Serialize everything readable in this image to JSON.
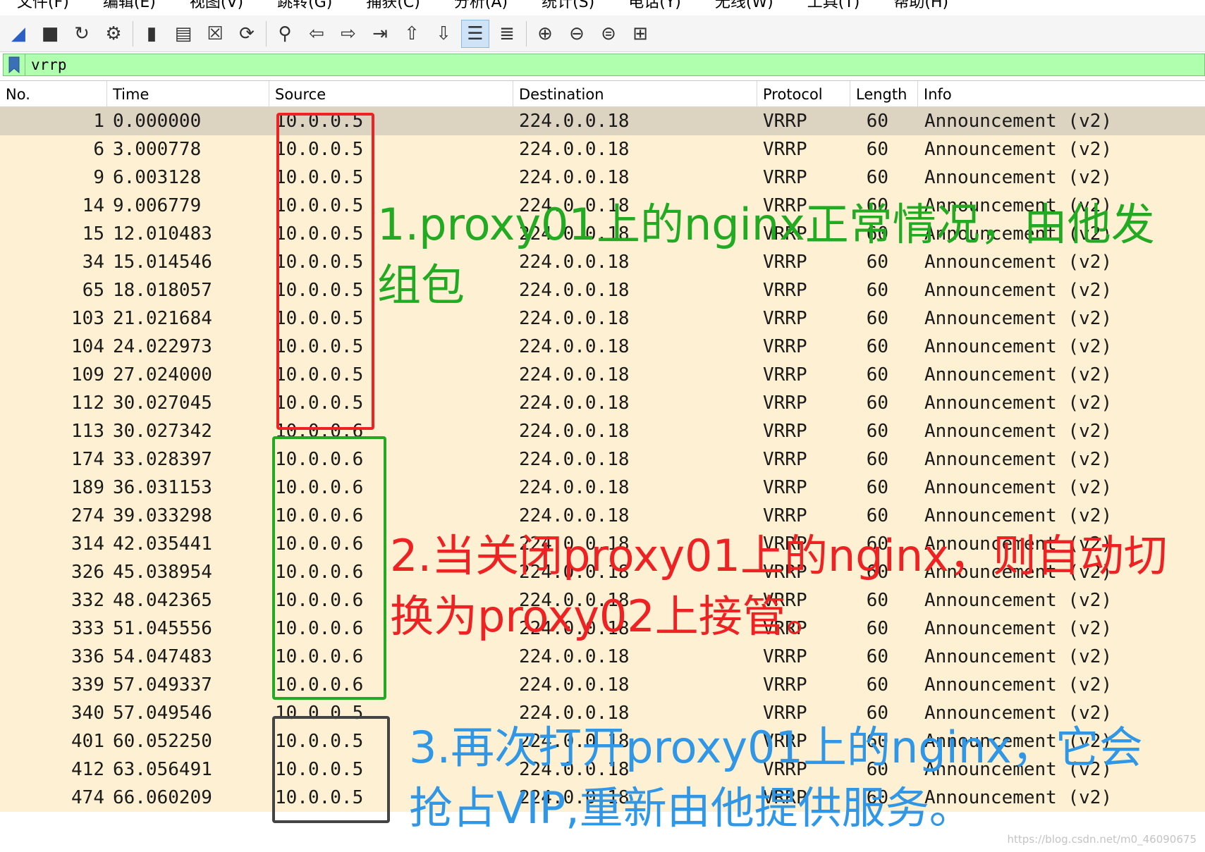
{
  "menu": {
    "items": [
      "文件(F)",
      "编辑(E)",
      "视图(V)",
      "跳转(G)",
      "捕获(C)",
      "分析(A)",
      "统计(S)",
      "电话(Y)",
      "无线(W)",
      "工具(T)",
      "帮助(H)"
    ]
  },
  "toolbar": {
    "buttons": [
      {
        "icon": "shark-fin-start-icon",
        "glyph": "◢"
      },
      {
        "icon": "stop-square-icon",
        "glyph": "■"
      },
      {
        "icon": "restart-fin-icon",
        "glyph": "↻"
      },
      {
        "icon": "capture-options-gear-icon",
        "glyph": "⚙"
      },
      {
        "icon": "open-folder-icon",
        "glyph": "▮"
      },
      {
        "icon": "save-file-icon",
        "glyph": "▤"
      },
      {
        "icon": "close-file-icon",
        "glyph": "☒"
      },
      {
        "icon": "reload-icon",
        "glyph": "⟳"
      },
      {
        "icon": "find-packet-icon",
        "glyph": "⚲"
      },
      {
        "icon": "go-back-icon",
        "glyph": "⇦"
      },
      {
        "icon": "go-forward-icon",
        "glyph": "⇨"
      },
      {
        "icon": "go-to-packet-icon",
        "glyph": "⇥"
      },
      {
        "icon": "go-first-icon",
        "glyph": "⇧"
      },
      {
        "icon": "go-last-icon",
        "glyph": "⇩"
      },
      {
        "icon": "auto-scroll-icon",
        "glyph": "☰"
      },
      {
        "icon": "colorize-icon",
        "glyph": "≣"
      },
      {
        "icon": "zoom-in-icon",
        "glyph": "⊕"
      },
      {
        "icon": "zoom-out-icon",
        "glyph": "⊖"
      },
      {
        "icon": "normal-size-icon",
        "glyph": "⊜"
      },
      {
        "icon": "resize-columns-icon",
        "glyph": "⊞"
      }
    ]
  },
  "filter": {
    "value": "vrrp",
    "bookmark_icon": "bookmark-icon",
    "background_color": "#afffaf"
  },
  "columns": {
    "no": "No.",
    "time": "Time",
    "source": "Source",
    "destination": "Destination",
    "protocol": "Protocol",
    "length": "Length",
    "info": "Info"
  },
  "packets": [
    {
      "no": "1",
      "time": "0.000000",
      "src": "10.0.0.5",
      "dst": "224.0.0.18",
      "proto": "VRRP",
      "len": "60",
      "info": "Announcement (v2)"
    },
    {
      "no": "6",
      "time": "3.000778",
      "src": "10.0.0.5",
      "dst": "224.0.0.18",
      "proto": "VRRP",
      "len": "60",
      "info": "Announcement (v2)"
    },
    {
      "no": "9",
      "time": "6.003128",
      "src": "10.0.0.5",
      "dst": "224.0.0.18",
      "proto": "VRRP",
      "len": "60",
      "info": "Announcement (v2)"
    },
    {
      "no": "14",
      "time": "9.006779",
      "src": "10.0.0.5",
      "dst": "224.0.0.18",
      "proto": "VRRP",
      "len": "60",
      "info": "Announcement (v2)"
    },
    {
      "no": "15",
      "time": "12.010483",
      "src": "10.0.0.5",
      "dst": "224.0.0.18",
      "proto": "VRRP",
      "len": "60",
      "info": "Announcement (v2)"
    },
    {
      "no": "34",
      "time": "15.014546",
      "src": "10.0.0.5",
      "dst": "224.0.0.18",
      "proto": "VRRP",
      "len": "60",
      "info": "Announcement (v2)"
    },
    {
      "no": "65",
      "time": "18.018057",
      "src": "10.0.0.5",
      "dst": "224.0.0.18",
      "proto": "VRRP",
      "len": "60",
      "info": "Announcement (v2)"
    },
    {
      "no": "103",
      "time": "21.021684",
      "src": "10.0.0.5",
      "dst": "224.0.0.18",
      "proto": "VRRP",
      "len": "60",
      "info": "Announcement (v2)"
    },
    {
      "no": "104",
      "time": "24.022973",
      "src": "10.0.0.5",
      "dst": "224.0.0.18",
      "proto": "VRRP",
      "len": "60",
      "info": "Announcement (v2)"
    },
    {
      "no": "109",
      "time": "27.024000",
      "src": "10.0.0.5",
      "dst": "224.0.0.18",
      "proto": "VRRP",
      "len": "60",
      "info": "Announcement (v2)"
    },
    {
      "no": "112",
      "time": "30.027045",
      "src": "10.0.0.5",
      "dst": "224.0.0.18",
      "proto": "VRRP",
      "len": "60",
      "info": "Announcement (v2)"
    },
    {
      "no": "113",
      "time": "30.027342",
      "src": "10.0.0.6",
      "dst": "224.0.0.18",
      "proto": "VRRP",
      "len": "60",
      "info": "Announcement (v2)"
    },
    {
      "no": "174",
      "time": "33.028397",
      "src": "10.0.0.6",
      "dst": "224.0.0.18",
      "proto": "VRRP",
      "len": "60",
      "info": "Announcement (v2)"
    },
    {
      "no": "189",
      "time": "36.031153",
      "src": "10.0.0.6",
      "dst": "224.0.0.18",
      "proto": "VRRP",
      "len": "60",
      "info": "Announcement (v2)"
    },
    {
      "no": "274",
      "time": "39.033298",
      "src": "10.0.0.6",
      "dst": "224.0.0.18",
      "proto": "VRRP",
      "len": "60",
      "info": "Announcement (v2)"
    },
    {
      "no": "314",
      "time": "42.035441",
      "src": "10.0.0.6",
      "dst": "224.0.0.18",
      "proto": "VRRP",
      "len": "60",
      "info": "Announcement (v2)"
    },
    {
      "no": "326",
      "time": "45.038954",
      "src": "10.0.0.6",
      "dst": "224.0.0.18",
      "proto": "VRRP",
      "len": "60",
      "info": "Announcement (v2)"
    },
    {
      "no": "332",
      "time": "48.042365",
      "src": "10.0.0.6",
      "dst": "224.0.0.18",
      "proto": "VRRP",
      "len": "60",
      "info": "Announcement (v2)"
    },
    {
      "no": "333",
      "time": "51.045556",
      "src": "10.0.0.6",
      "dst": "224.0.0.18",
      "proto": "VRRP",
      "len": "60",
      "info": "Announcement (v2)"
    },
    {
      "no": "336",
      "time": "54.047483",
      "src": "10.0.0.6",
      "dst": "224.0.0.18",
      "proto": "VRRP",
      "len": "60",
      "info": "Announcement (v2)"
    },
    {
      "no": "339",
      "time": "57.049337",
      "src": "10.0.0.6",
      "dst": "224.0.0.18",
      "proto": "VRRP",
      "len": "60",
      "info": "Announcement (v2)"
    },
    {
      "no": "340",
      "time": "57.049546",
      "src": "10.0.0.5",
      "dst": "224.0.0.18",
      "proto": "VRRP",
      "len": "60",
      "info": "Announcement (v2)"
    },
    {
      "no": "401",
      "time": "60.052250",
      "src": "10.0.0.5",
      "dst": "224.0.0.18",
      "proto": "VRRP",
      "len": "60",
      "info": "Announcement (v2)"
    },
    {
      "no": "412",
      "time": "63.056491",
      "src": "10.0.0.5",
      "dst": "224.0.0.18",
      "proto": "VRRP",
      "len": "60",
      "info": "Announcement (v2)"
    },
    {
      "no": "474",
      "time": "66.060209",
      "src": "10.0.0.5",
      "dst": "224.0.0.18",
      "proto": "VRRP",
      "len": "60",
      "info": "Announcement (v2)"
    }
  ],
  "row_colors": {
    "normal": "#fdf0d3",
    "selected": "#dcd3c1"
  },
  "annotations": {
    "note1": "1.proxy01上的nginx正常情况，由他发组包",
    "note2": "2.当关闭proxy01上的nginx，则自动切换为proxy02上接管。",
    "note3": "3.再次打开proxy01上的nginx，它会抢占VIP,重新由他提供服务。",
    "colors": {
      "red": "#ee2222",
      "green": "#22aa22",
      "blue": "#2f97e6",
      "gray": "#444444"
    }
  },
  "watermark": "https://blog.csdn.net/m0_46090675"
}
